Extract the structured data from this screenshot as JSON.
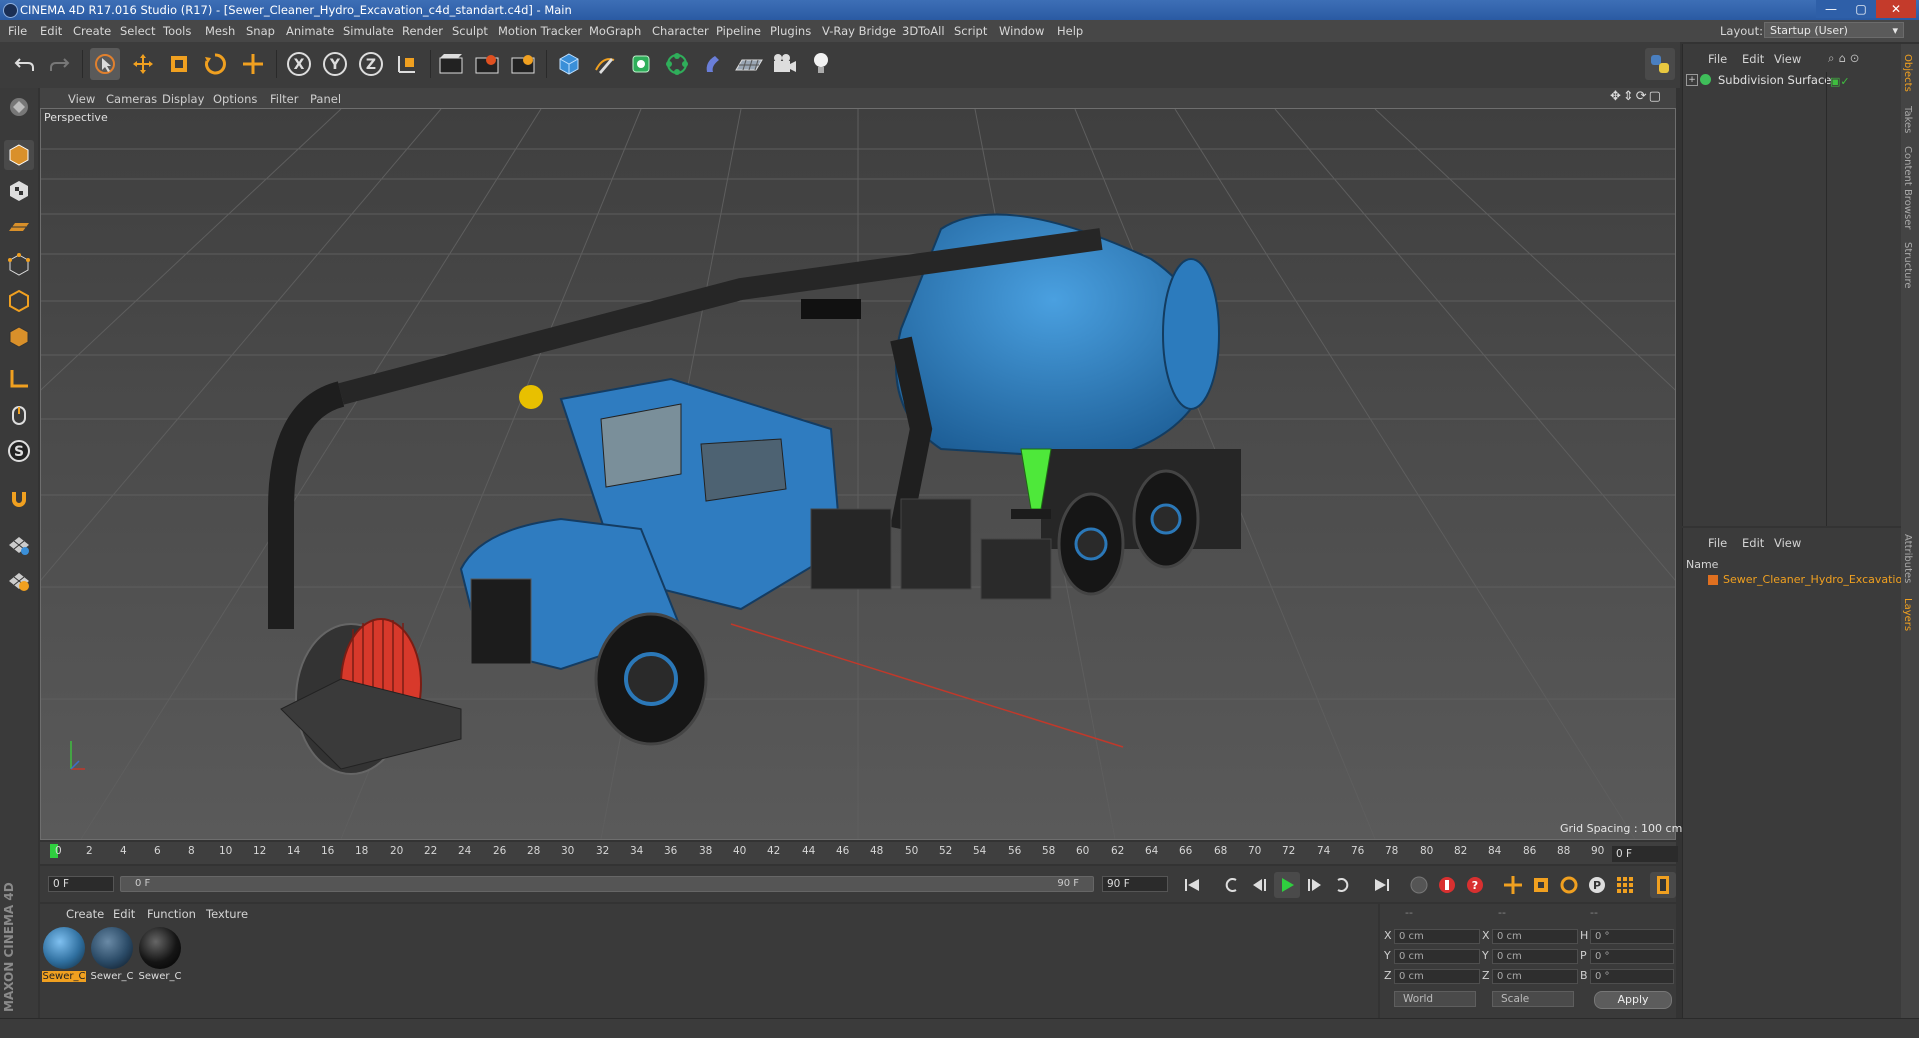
{
  "window": {
    "title": "CINEMA 4D R17.016 Studio (R17) - [Sewer_Cleaner_Hydro_Excavation_c4d_standart.c4d] - Main",
    "controls": {
      "minimize": "—",
      "maximize": "▢",
      "close": "✕"
    }
  },
  "menubar": {
    "items": [
      "File",
      "Edit",
      "Create",
      "Select",
      "Tools",
      "Mesh",
      "Snap",
      "Animate",
      "Simulate",
      "Render",
      "Sculpt",
      "Motion Tracker",
      "MoGraph",
      "Character",
      "Pipeline",
      "Plugins",
      "V-Ray Bridge",
      "3DToAll",
      "Script",
      "Window",
      "Help"
    ],
    "layout_label": "Layout:",
    "layout_value": "Startup (User)"
  },
  "toolbar": {
    "axis_x": "X",
    "axis_y": "Y",
    "axis_z": "Z",
    "icons": [
      "undo-icon",
      "redo-icon",
      "select-arrow-icon",
      "move-icon",
      "scale-icon",
      "rotate-icon",
      "multi-axis-icon",
      "lock-x-icon",
      "lock-y-icon",
      "lock-z-icon",
      "world-coord-icon",
      "render-view-icon",
      "render-picture-icon",
      "render-settings-icon",
      "cube-icon",
      "pen-icon",
      "subdivide-icon",
      "array-icon",
      "deformer-icon",
      "floor-icon",
      "camera-icon",
      "light-icon",
      "python-icon"
    ]
  },
  "viewport": {
    "menu": [
      "View",
      "Cameras",
      "Display",
      "Options",
      "Filter",
      "Panel"
    ],
    "label": "Perspective",
    "grid_spacing": "Grid Spacing : 100 cm"
  },
  "timeline": {
    "ticks": [
      "0",
      "2",
      "4",
      "6",
      "8",
      "10",
      "12",
      "14",
      "16",
      "18",
      "20",
      "22",
      "24",
      "26",
      "28",
      "30",
      "32",
      "34",
      "36",
      "38",
      "40",
      "42",
      "44",
      "46",
      "48",
      "50",
      "52",
      "54",
      "56",
      "58",
      "60",
      "62",
      "64",
      "66",
      "68",
      "70",
      "72",
      "74",
      "76",
      "78",
      "80",
      "82",
      "84",
      "86",
      "88",
      "90"
    ],
    "current_frame": "0 F",
    "start_frame": "0 F",
    "range_start": "0 F",
    "range_end": "90 F",
    "end_frame": "90 F"
  },
  "material_panel": {
    "menu": [
      "Create",
      "Edit",
      "Function",
      "Texture"
    ],
    "materials": [
      {
        "label": "Sewer_C",
        "color": "#2f6f9f",
        "selected": true
      },
      {
        "label": "Sewer_C",
        "color": "#2a4a66",
        "selected": false
      },
      {
        "label": "Sewer_C",
        "color": "#151515",
        "selected": false
      }
    ],
    "logo_text": "MAXON CINEMA 4D"
  },
  "coordinates": {
    "headers": [
      "--",
      "--",
      "--"
    ],
    "rows": [
      {
        "a_label": "X",
        "a_val": "0 cm",
        "b_label": "X",
        "b_val": "0 cm",
        "c_label": "H",
        "c_val": "0 °"
      },
      {
        "a_label": "Y",
        "a_val": "0 cm",
        "b_label": "Y",
        "b_val": "0 cm",
        "c_label": "P",
        "c_val": "0 °"
      },
      {
        "a_label": "Z",
        "a_val": "0 cm",
        "b_label": "Z",
        "b_val": "0 cm",
        "c_label": "B",
        "c_val": "0 °"
      }
    ],
    "mode_world": "World",
    "mode_scale": "Scale",
    "apply": "Apply"
  },
  "object_manager": {
    "menu": [
      "File",
      "Edit",
      "View"
    ],
    "objects": [
      {
        "name": "Subdivision Surface"
      }
    ]
  },
  "layer_manager": {
    "menu": [
      "File",
      "Edit",
      "View"
    ],
    "column": "Name",
    "layers": [
      {
        "name": "Sewer_Cleaner_Hydro_Excavation",
        "color": "#e07020"
      }
    ]
  },
  "side_tabs": [
    "Objects",
    "Takes",
    "Content Browser",
    "Structure",
    "Attributes",
    "Layers"
  ],
  "colors": {
    "accent": "#f0a040",
    "viewport_bg": "#4b4b4b",
    "truck_blue": "#2b78b8",
    "hose_red": "#d8392b",
    "cone_green": "#4ee83a"
  }
}
